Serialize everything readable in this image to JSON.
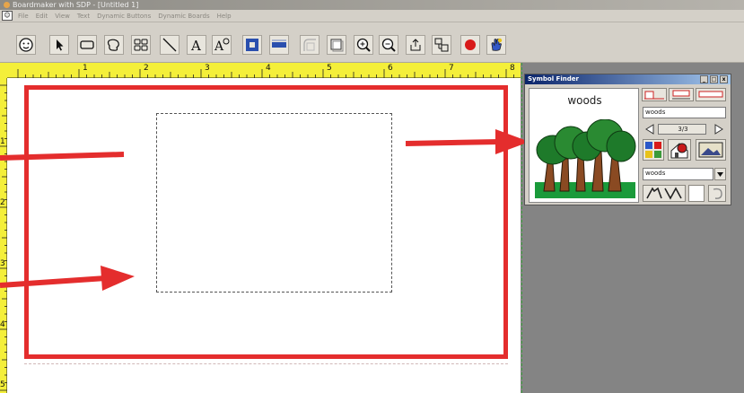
{
  "window": {
    "title": "Boardmaker with SDP - [Untitled 1]"
  },
  "menu": {
    "items": [
      "File",
      "Edit",
      "View",
      "Text",
      "Dynamic Buttons",
      "Dynamic Boards",
      "Help"
    ]
  },
  "toolbar": {
    "tools": [
      "speaker-face-icon",
      "pointer-icon",
      "rectangle-icon",
      "freeform-icon",
      "grid-icon",
      "line-icon",
      "text-icon",
      "symbol-text-icon",
      "fill-color-icon",
      "line-thickness-icon",
      "corner-icon",
      "shadow-icon",
      "zoom-in-icon",
      "zoom-out-icon",
      "export-icon",
      "spacing-icon",
      "record-icon",
      "hand-icon"
    ]
  },
  "rulers": {
    "horizontal_numbers": [
      "1",
      "2",
      "3",
      "4",
      "5",
      "6",
      "7",
      "8"
    ],
    "vertical_numbers": [
      "1",
      "2",
      "3",
      "4",
      "5"
    ]
  },
  "symbol_finder": {
    "title": "Symbol Finder",
    "word": "woods",
    "search_text": "woods",
    "page_counter": "3/3",
    "category_value": "woods"
  },
  "colors": {
    "page_border": "#e42d2d",
    "ruler": "#f4ef3a",
    "arrow": "#e42d2d"
  }
}
